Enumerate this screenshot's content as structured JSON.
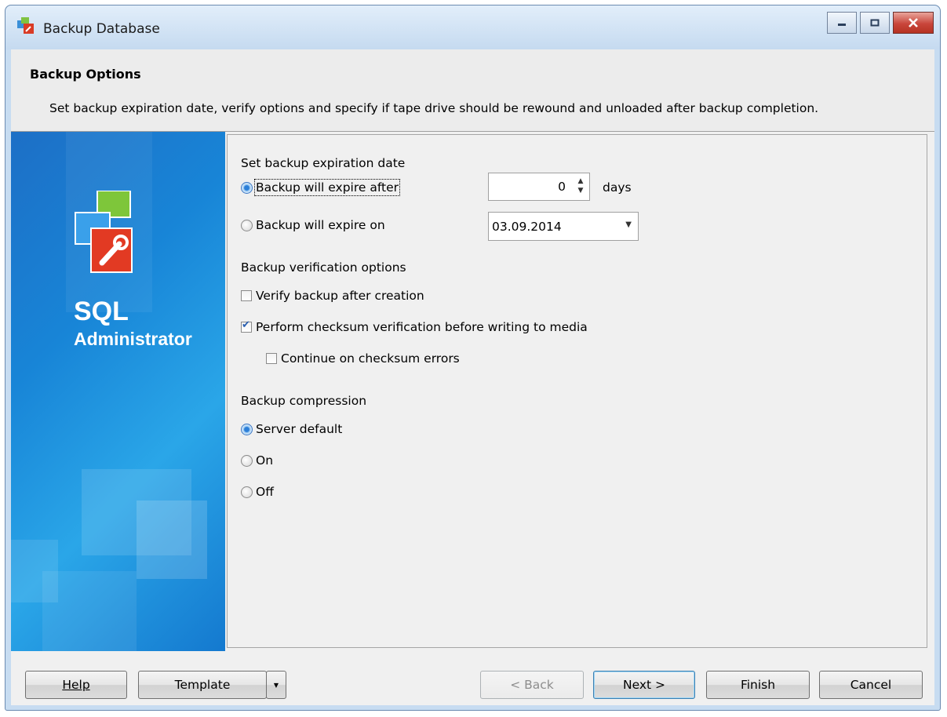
{
  "window": {
    "title": "Backup Database"
  },
  "header": {
    "title": "Backup Options",
    "description": "Set backup expiration date, verify options and specify if tape drive should be rewound and unloaded after backup completion."
  },
  "sidebar": {
    "brand_line1": "SQL",
    "brand_line2": "Administrator"
  },
  "expiration": {
    "heading": "Set backup expiration date",
    "after_label": "Backup will expire after",
    "after_selected": true,
    "days_value": "0",
    "days_unit": "days",
    "on_label": "Backup will expire on",
    "on_selected": false,
    "date_value": "03.09.2014"
  },
  "verification": {
    "heading": "Backup verification options",
    "verify_label": "Verify backup after creation",
    "verify_checked": false,
    "checksum_label": "Perform checksum verification before writing to media",
    "checksum_checked": true,
    "continue_label": "Continue on checksum errors",
    "continue_checked": false
  },
  "compression": {
    "heading": "Backup compression",
    "options": [
      {
        "label": "Server default",
        "selected": true
      },
      {
        "label": "On",
        "selected": false
      },
      {
        "label": "Off",
        "selected": false
      }
    ]
  },
  "buttons": {
    "help": "Help",
    "template": "Template",
    "back": "< Back",
    "next": "Next >",
    "finish": "Finish",
    "cancel": "Cancel"
  },
  "colors": {
    "titlebar": "#c5daf0",
    "sidebar": "#1885d7",
    "close_button": "#c9463b",
    "accent_check": "#2a5fb0"
  }
}
